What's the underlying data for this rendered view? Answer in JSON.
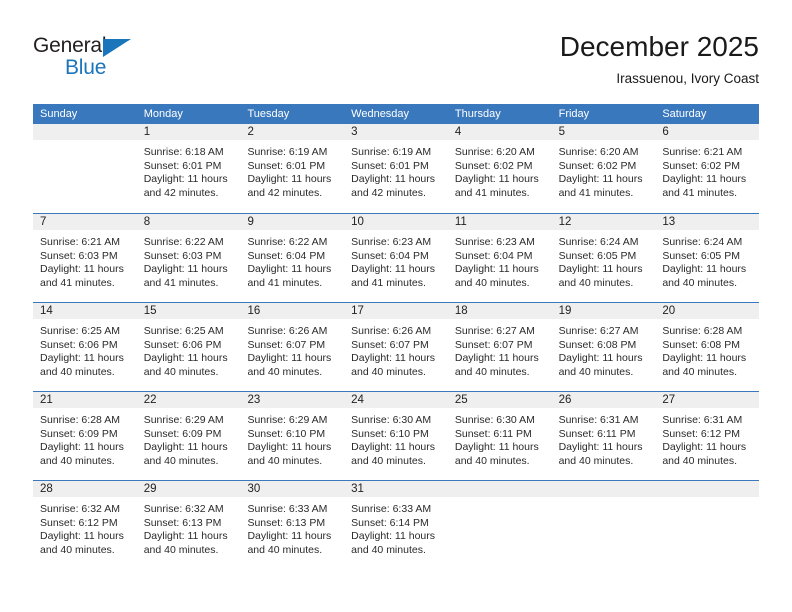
{
  "brand": {
    "name_part1": "General",
    "name_part2": "Blue",
    "accent_color": "#1b75bb"
  },
  "header": {
    "title": "December 2025",
    "subtitle": "Irassuenou, Ivory Coast"
  },
  "theme": {
    "header_row_color": "#3a78bd",
    "date_strip_color": "#efefef",
    "grid_line_color": "#3a78bd"
  },
  "weekday_headers": [
    "Sunday",
    "Monday",
    "Tuesday",
    "Wednesday",
    "Thursday",
    "Friday",
    "Saturday"
  ],
  "weeks": [
    [
      {
        "day": "",
        "empty": true,
        "sunrise": "",
        "sunset": "",
        "daylight_line1": "",
        "daylight_line2": ""
      },
      {
        "day": "1",
        "sunrise": "Sunrise: 6:18 AM",
        "sunset": "Sunset: 6:01 PM",
        "daylight_line1": "Daylight: 11 hours",
        "daylight_line2": "and 42 minutes."
      },
      {
        "day": "2",
        "sunrise": "Sunrise: 6:19 AM",
        "sunset": "Sunset: 6:01 PM",
        "daylight_line1": "Daylight: 11 hours",
        "daylight_line2": "and 42 minutes."
      },
      {
        "day": "3",
        "sunrise": "Sunrise: 6:19 AM",
        "sunset": "Sunset: 6:01 PM",
        "daylight_line1": "Daylight: 11 hours",
        "daylight_line2": "and 42 minutes."
      },
      {
        "day": "4",
        "sunrise": "Sunrise: 6:20 AM",
        "sunset": "Sunset: 6:02 PM",
        "daylight_line1": "Daylight: 11 hours",
        "daylight_line2": "and 41 minutes."
      },
      {
        "day": "5",
        "sunrise": "Sunrise: 6:20 AM",
        "sunset": "Sunset: 6:02 PM",
        "daylight_line1": "Daylight: 11 hours",
        "daylight_line2": "and 41 minutes."
      },
      {
        "day": "6",
        "sunrise": "Sunrise: 6:21 AM",
        "sunset": "Sunset: 6:02 PM",
        "daylight_line1": "Daylight: 11 hours",
        "daylight_line2": "and 41 minutes."
      }
    ],
    [
      {
        "day": "7",
        "sunrise": "Sunrise: 6:21 AM",
        "sunset": "Sunset: 6:03 PM",
        "daylight_line1": "Daylight: 11 hours",
        "daylight_line2": "and 41 minutes."
      },
      {
        "day": "8",
        "sunrise": "Sunrise: 6:22 AM",
        "sunset": "Sunset: 6:03 PM",
        "daylight_line1": "Daylight: 11 hours",
        "daylight_line2": "and 41 minutes."
      },
      {
        "day": "9",
        "sunrise": "Sunrise: 6:22 AM",
        "sunset": "Sunset: 6:04 PM",
        "daylight_line1": "Daylight: 11 hours",
        "daylight_line2": "and 41 minutes."
      },
      {
        "day": "10",
        "sunrise": "Sunrise: 6:23 AM",
        "sunset": "Sunset: 6:04 PM",
        "daylight_line1": "Daylight: 11 hours",
        "daylight_line2": "and 41 minutes."
      },
      {
        "day": "11",
        "sunrise": "Sunrise: 6:23 AM",
        "sunset": "Sunset: 6:04 PM",
        "daylight_line1": "Daylight: 11 hours",
        "daylight_line2": "and 40 minutes."
      },
      {
        "day": "12",
        "sunrise": "Sunrise: 6:24 AM",
        "sunset": "Sunset: 6:05 PM",
        "daylight_line1": "Daylight: 11 hours",
        "daylight_line2": "and 40 minutes."
      },
      {
        "day": "13",
        "sunrise": "Sunrise: 6:24 AM",
        "sunset": "Sunset: 6:05 PM",
        "daylight_line1": "Daylight: 11 hours",
        "daylight_line2": "and 40 minutes."
      }
    ],
    [
      {
        "day": "14",
        "sunrise": "Sunrise: 6:25 AM",
        "sunset": "Sunset: 6:06 PM",
        "daylight_line1": "Daylight: 11 hours",
        "daylight_line2": "and 40 minutes."
      },
      {
        "day": "15",
        "sunrise": "Sunrise: 6:25 AM",
        "sunset": "Sunset: 6:06 PM",
        "daylight_line1": "Daylight: 11 hours",
        "daylight_line2": "and 40 minutes."
      },
      {
        "day": "16",
        "sunrise": "Sunrise: 6:26 AM",
        "sunset": "Sunset: 6:07 PM",
        "daylight_line1": "Daylight: 11 hours",
        "daylight_line2": "and 40 minutes."
      },
      {
        "day": "17",
        "sunrise": "Sunrise: 6:26 AM",
        "sunset": "Sunset: 6:07 PM",
        "daylight_line1": "Daylight: 11 hours",
        "daylight_line2": "and 40 minutes."
      },
      {
        "day": "18",
        "sunrise": "Sunrise: 6:27 AM",
        "sunset": "Sunset: 6:07 PM",
        "daylight_line1": "Daylight: 11 hours",
        "daylight_line2": "and 40 minutes."
      },
      {
        "day": "19",
        "sunrise": "Sunrise: 6:27 AM",
        "sunset": "Sunset: 6:08 PM",
        "daylight_line1": "Daylight: 11 hours",
        "daylight_line2": "and 40 minutes."
      },
      {
        "day": "20",
        "sunrise": "Sunrise: 6:28 AM",
        "sunset": "Sunset: 6:08 PM",
        "daylight_line1": "Daylight: 11 hours",
        "daylight_line2": "and 40 minutes."
      }
    ],
    [
      {
        "day": "21",
        "sunrise": "Sunrise: 6:28 AM",
        "sunset": "Sunset: 6:09 PM",
        "daylight_line1": "Daylight: 11 hours",
        "daylight_line2": "and 40 minutes."
      },
      {
        "day": "22",
        "sunrise": "Sunrise: 6:29 AM",
        "sunset": "Sunset: 6:09 PM",
        "daylight_line1": "Daylight: 11 hours",
        "daylight_line2": "and 40 minutes."
      },
      {
        "day": "23",
        "sunrise": "Sunrise: 6:29 AM",
        "sunset": "Sunset: 6:10 PM",
        "daylight_line1": "Daylight: 11 hours",
        "daylight_line2": "and 40 minutes."
      },
      {
        "day": "24",
        "sunrise": "Sunrise: 6:30 AM",
        "sunset": "Sunset: 6:10 PM",
        "daylight_line1": "Daylight: 11 hours",
        "daylight_line2": "and 40 minutes."
      },
      {
        "day": "25",
        "sunrise": "Sunrise: 6:30 AM",
        "sunset": "Sunset: 6:11 PM",
        "daylight_line1": "Daylight: 11 hours",
        "daylight_line2": "and 40 minutes."
      },
      {
        "day": "26",
        "sunrise": "Sunrise: 6:31 AM",
        "sunset": "Sunset: 6:11 PM",
        "daylight_line1": "Daylight: 11 hours",
        "daylight_line2": "and 40 minutes."
      },
      {
        "day": "27",
        "sunrise": "Sunrise: 6:31 AM",
        "sunset": "Sunset: 6:12 PM",
        "daylight_line1": "Daylight: 11 hours",
        "daylight_line2": "and 40 minutes."
      }
    ],
    [
      {
        "day": "28",
        "sunrise": "Sunrise: 6:32 AM",
        "sunset": "Sunset: 6:12 PM",
        "daylight_line1": "Daylight: 11 hours",
        "daylight_line2": "and 40 minutes."
      },
      {
        "day": "29",
        "sunrise": "Sunrise: 6:32 AM",
        "sunset": "Sunset: 6:13 PM",
        "daylight_line1": "Daylight: 11 hours",
        "daylight_line2": "and 40 minutes."
      },
      {
        "day": "30",
        "sunrise": "Sunrise: 6:33 AM",
        "sunset": "Sunset: 6:13 PM",
        "daylight_line1": "Daylight: 11 hours",
        "daylight_line2": "and 40 minutes."
      },
      {
        "day": "31",
        "sunrise": "Sunrise: 6:33 AM",
        "sunset": "Sunset: 6:14 PM",
        "daylight_line1": "Daylight: 11 hours",
        "daylight_line2": "and 40 minutes."
      },
      {
        "day": "",
        "empty": true,
        "sunrise": "",
        "sunset": "",
        "daylight_line1": "",
        "daylight_line2": ""
      },
      {
        "day": "",
        "empty": true,
        "sunrise": "",
        "sunset": "",
        "daylight_line1": "",
        "daylight_line2": ""
      },
      {
        "day": "",
        "empty": true,
        "sunrise": "",
        "sunset": "",
        "daylight_line1": "",
        "daylight_line2": ""
      }
    ]
  ]
}
